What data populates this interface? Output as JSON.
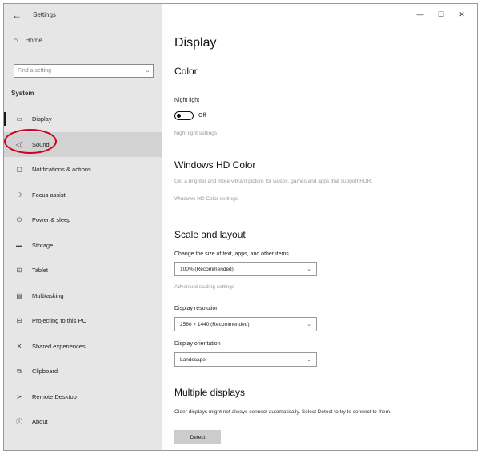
{
  "window": {
    "back": "←",
    "title": "Settings",
    "controls": {
      "minimize": "—",
      "maximize": "☐",
      "close": "✕"
    }
  },
  "sidebar": {
    "home": {
      "icon": "⌂",
      "label": "Home"
    },
    "search": {
      "placeholder": "Find a setting",
      "icon": "⌕"
    },
    "section": "System",
    "items": [
      {
        "icon": "▭",
        "label": "Display"
      },
      {
        "icon": "◁)",
        "label": "Sound"
      },
      {
        "icon": "▢",
        "label": "Notifications & actions"
      },
      {
        "icon": "☽",
        "label": "Focus assist"
      },
      {
        "icon": "⏻",
        "label": "Power & sleep"
      },
      {
        "icon": "▬",
        "label": "Storage"
      },
      {
        "icon": "⊡",
        "label": "Tablet"
      },
      {
        "icon": "▤",
        "label": "Multitasking"
      },
      {
        "icon": "⊟",
        "label": "Projecting to this PC"
      },
      {
        "icon": "✕",
        "label": "Shared experiences"
      },
      {
        "icon": "⧉",
        "label": "Clipboard"
      },
      {
        "icon": "≻",
        "label": "Remote Desktop"
      },
      {
        "icon": "ⓘ",
        "label": "About"
      }
    ]
  },
  "main": {
    "title": "Display",
    "color": {
      "heading": "Color",
      "night_light_label": "Night light",
      "night_light_state": "Off",
      "night_light_link": "Night light settings"
    },
    "hdr": {
      "heading": "Windows HD Color",
      "description": "Get a brighter and more vibrant picture for videos, games and apps that support HDR.",
      "link": "Windows HD Color settings"
    },
    "scale": {
      "heading": "Scale and layout",
      "size_label": "Change the size of text, apps, and other items",
      "size_value": "100% (Recommended)",
      "advanced_link": "Advanced scaling settings",
      "resolution_label": "Display resolution",
      "resolution_value": "2560 × 1440 (Recommended)",
      "orientation_label": "Display orientation",
      "orientation_value": "Landscape"
    },
    "multiple": {
      "heading": "Multiple displays",
      "description": "Older displays might not always connect automatically. Select Detect to try to connect to them.",
      "detect_button": "Detect"
    }
  }
}
